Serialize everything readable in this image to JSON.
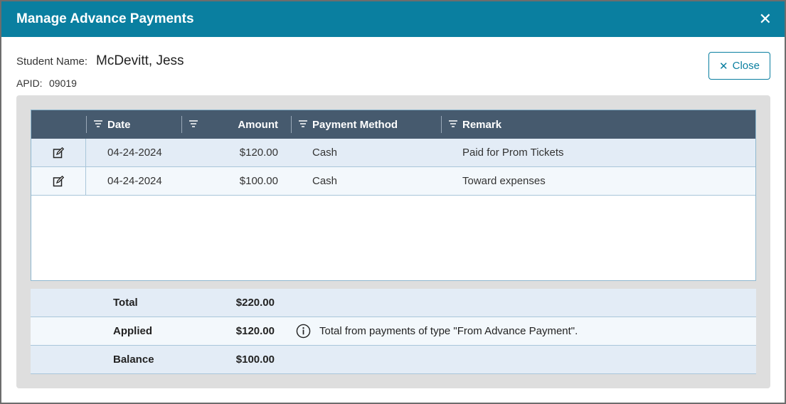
{
  "modal": {
    "title": "Manage Advance Payments",
    "close_label": "Close"
  },
  "student": {
    "name_label": "Student Name:",
    "name": "McDevitt, Jess",
    "apid_label": "APID:",
    "apid": "09019"
  },
  "grid": {
    "columns": [
      "Date",
      "Amount",
      "Payment Method",
      "Remark"
    ],
    "rows": [
      {
        "date": "04-24-2024",
        "amount": "$120.00",
        "method": "Cash",
        "remark": "Paid for Prom Tickets"
      },
      {
        "date": "04-24-2024",
        "amount": "$100.00",
        "method": "Cash",
        "remark": "Toward expenses"
      }
    ]
  },
  "summary": {
    "total_label": "Total",
    "total": "$220.00",
    "applied_label": "Applied",
    "applied": "$120.00",
    "applied_note": "Total from payments of type \"From Advance Payment\".",
    "balance_label": "Balance",
    "balance": "$100.00"
  },
  "colors": {
    "header": "#0a7fa0",
    "grid_header": "#465a6e",
    "row_odd": "#e3ecf6",
    "row_even": "#f3f8fc"
  },
  "icons": [
    "close-icon",
    "filter-icon",
    "edit-icon",
    "info-icon"
  ]
}
